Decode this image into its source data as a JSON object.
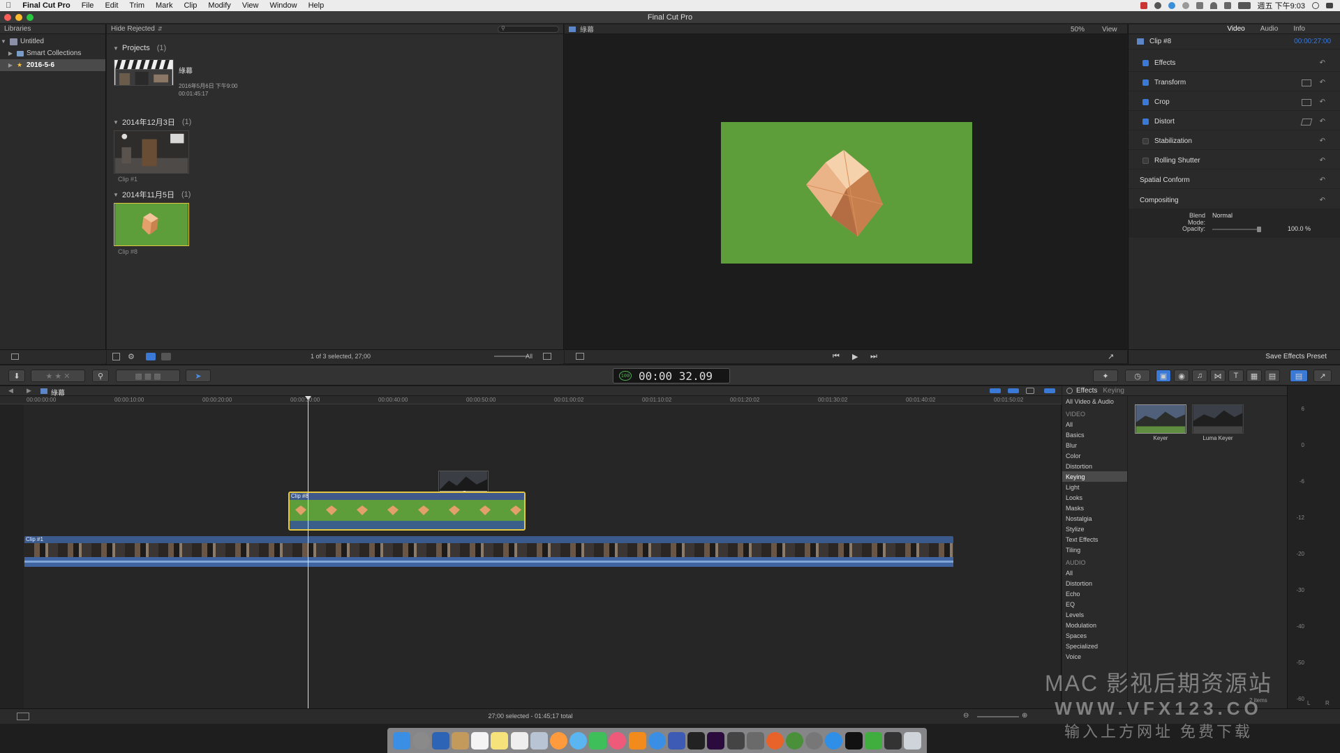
{
  "menubar": {
    "app_name": "Final Cut Pro",
    "items": [
      "File",
      "Edit",
      "Trim",
      "Mark",
      "Clip",
      "Modify",
      "View",
      "Window",
      "Help"
    ],
    "clock": "週五 下午9:03"
  },
  "window": {
    "title": "Final Cut Pro"
  },
  "libraries": {
    "header": "Libraries",
    "items": [
      {
        "label": "Untitled"
      },
      {
        "label": "Smart Collections"
      },
      {
        "label": "2016-5-6"
      }
    ]
  },
  "browser": {
    "filter": "Hide Rejected",
    "sections": [
      {
        "title": "Projects",
        "count": "(1)"
      },
      {
        "title": "2014年12月3日",
        "count": "(1)"
      },
      {
        "title": "2014年11月5日",
        "count": "(1)"
      }
    ],
    "project": {
      "name": "綠幕",
      "date": "2016年5月6日 下午9:00",
      "duration": "00:01:45:17"
    },
    "clips": [
      "Clip #1",
      "Clip #8"
    ],
    "selection_status": "1 of 3 selected, 27;00",
    "filter_all": "All"
  },
  "viewer": {
    "title": "綠幕",
    "zoom": "50%",
    "view_label": "View"
  },
  "inspector": {
    "tabs": [
      "Video",
      "Audio",
      "Info"
    ],
    "clip_name": "Clip #8",
    "duration": "00:00:27:00",
    "rows": [
      "Effects",
      "Transform",
      "Crop",
      "Distort",
      "Stabilization",
      "Rolling Shutter",
      "Spatial Conform",
      "Compositing"
    ],
    "blend_mode_label": "Blend Mode:",
    "blend_mode_value": "Normal",
    "opacity_label": "Opacity:",
    "opacity_value": "100.0 %",
    "opacity_level": 1.0,
    "save_preset": "Save Effects Preset"
  },
  "toolbar": {
    "timecode_badge": "100",
    "timecode": "00:00 32.09"
  },
  "timeline": {
    "project_name": "綠幕",
    "ruler": [
      "00:00:00:00",
      "00:00:10:00",
      "00:00:20:00",
      "00:00:30:00",
      "00:00:40:00",
      "00:00:50:00",
      "00:01:00:02",
      "00:01:10:02",
      "00:01:20:02",
      "00:01:30:02",
      "00:01:40:02",
      "00:01:50:02"
    ],
    "connected_clip": "Clip #8",
    "primary_clip": "Clip #1"
  },
  "effects_browser": {
    "tabs": [
      "Effects",
      "Keying"
    ],
    "all_label": "All Video & Audio",
    "video_header": "VIDEO",
    "video_items": [
      "All",
      "Basics",
      "Blur",
      "Color",
      "Distortion",
      "Keying",
      "Light",
      "Looks",
      "Masks",
      "Nostalgia",
      "Stylize",
      "Text Effects",
      "Tiling"
    ],
    "audio_header": "AUDIO",
    "audio_items": [
      "All",
      "Distortion",
      "Echo",
      "EQ",
      "Levels",
      "Modulation",
      "Spaces",
      "Specialized",
      "Voice"
    ],
    "results": [
      "Keyer",
      "Luma Keyer"
    ],
    "count": "2 items"
  },
  "meters": {
    "scale": [
      "6",
      "0",
      "-6",
      "-12",
      "-20",
      "-30",
      "-40",
      "-50",
      "-60"
    ],
    "channels": [
      "L",
      "R"
    ]
  },
  "status": {
    "timeline_status": "27;00 selected - 01:45;17 total"
  },
  "watermark": {
    "line1": "MAC 影视后期资源站",
    "line2": "WWW.VFX123.CO",
    "line3": "输入上方网址  免费下载"
  },
  "colors": {
    "accent_blue": "#3b79d6",
    "green_screen": "#5e9e3a",
    "clip_yellow": "#e8c740",
    "selection_gray": "#4a4a4a"
  }
}
